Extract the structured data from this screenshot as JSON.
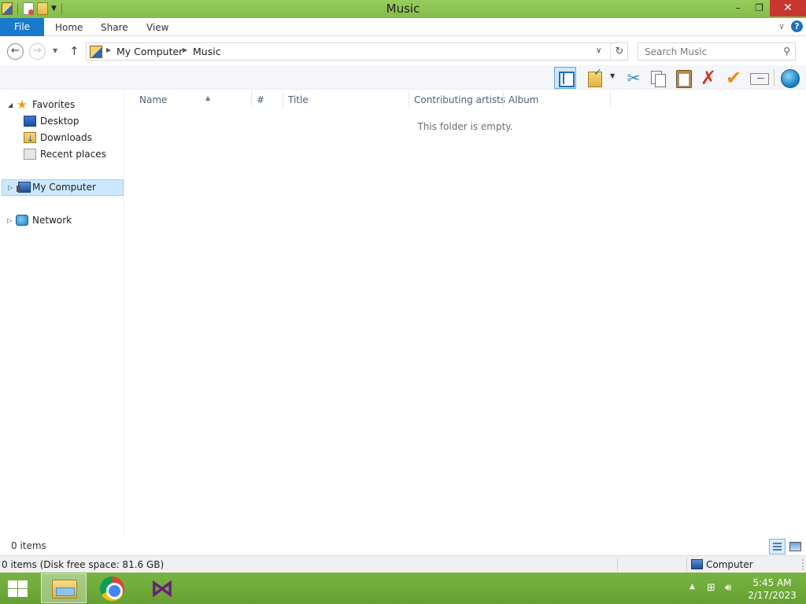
{
  "window": {
    "title": "Music",
    "buttons": {
      "minimize": "–",
      "maximize": "❐",
      "close": "✕"
    }
  },
  "ribbon": {
    "tabs": [
      "File",
      "Home",
      "Share",
      "View"
    ],
    "expand_glyph": "∨",
    "help_glyph": "?"
  },
  "address": {
    "breadcrumbs": [
      "My Computer",
      "Music"
    ],
    "separator": "▶"
  },
  "search": {
    "placeholder": "Search Music"
  },
  "toolbar": {
    "icons": [
      "layout-pane-icon",
      "folder-check-icon",
      "cut-icon",
      "copy-icon",
      "paste-icon",
      "delete-icon",
      "checkmark-icon",
      "rename-icon",
      "globe-icon"
    ]
  },
  "navpane": {
    "favorites": {
      "label": "Favorites",
      "items": [
        "Desktop",
        "Downloads",
        "Recent places"
      ]
    },
    "computer": "My Computer",
    "network": "Network"
  },
  "columns": [
    "Name",
    "#",
    "Title",
    "Contributing artists",
    "Album"
  ],
  "content": {
    "empty_message": "This folder is empty."
  },
  "status": {
    "item_count": "0 items",
    "detail": "0 items (Disk free space: 81.6 GB)",
    "location": "Computer"
  },
  "taskbar": {
    "apps": [
      "File Explorer",
      "Google Chrome",
      "Visual Studio"
    ],
    "time": "5:45 AM",
    "date": "2/17/2023"
  },
  "colors": {
    "titlebar": "#8cc152",
    "file_tab": "#1979ca",
    "selection": "#cce8ff",
    "taskbar": "#6fa83b",
    "close_button": "#c7372f"
  }
}
